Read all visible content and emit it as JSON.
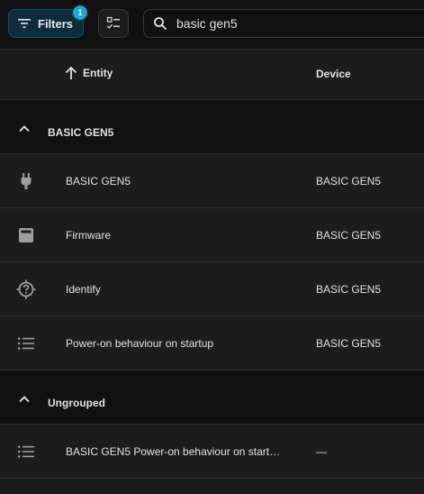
{
  "toolbar": {
    "filters_label": "Filters",
    "filters_badge": "1",
    "search_value": "basic gen5"
  },
  "table": {
    "columns": {
      "entity": "Entity",
      "device": "Device"
    },
    "groups": [
      {
        "label": "BASIC GEN5",
        "rows": [
          {
            "icon": "plug-icon",
            "name": "BASIC GEN5",
            "device": "BASIC GEN5"
          },
          {
            "icon": "firmware-icon",
            "name": "Firmware",
            "device": "BASIC GEN5"
          },
          {
            "icon": "identify-icon",
            "name": "Identify",
            "device": "BASIC GEN5"
          },
          {
            "icon": "list-icon",
            "name": "Power-on behaviour on startup",
            "device": "BASIC GEN5"
          }
        ]
      },
      {
        "label": "Ungrouped",
        "rows": [
          {
            "icon": "list-icon",
            "name": "BASIC GEN5 Power-on behaviour on start…",
            "device": "—"
          }
        ]
      }
    ]
  },
  "colors": {
    "background": "#111111",
    "row": "#1c1c1c",
    "accent": "#1fa6d8",
    "text": "#e1e1e1",
    "icon": "#9e9e9e"
  }
}
